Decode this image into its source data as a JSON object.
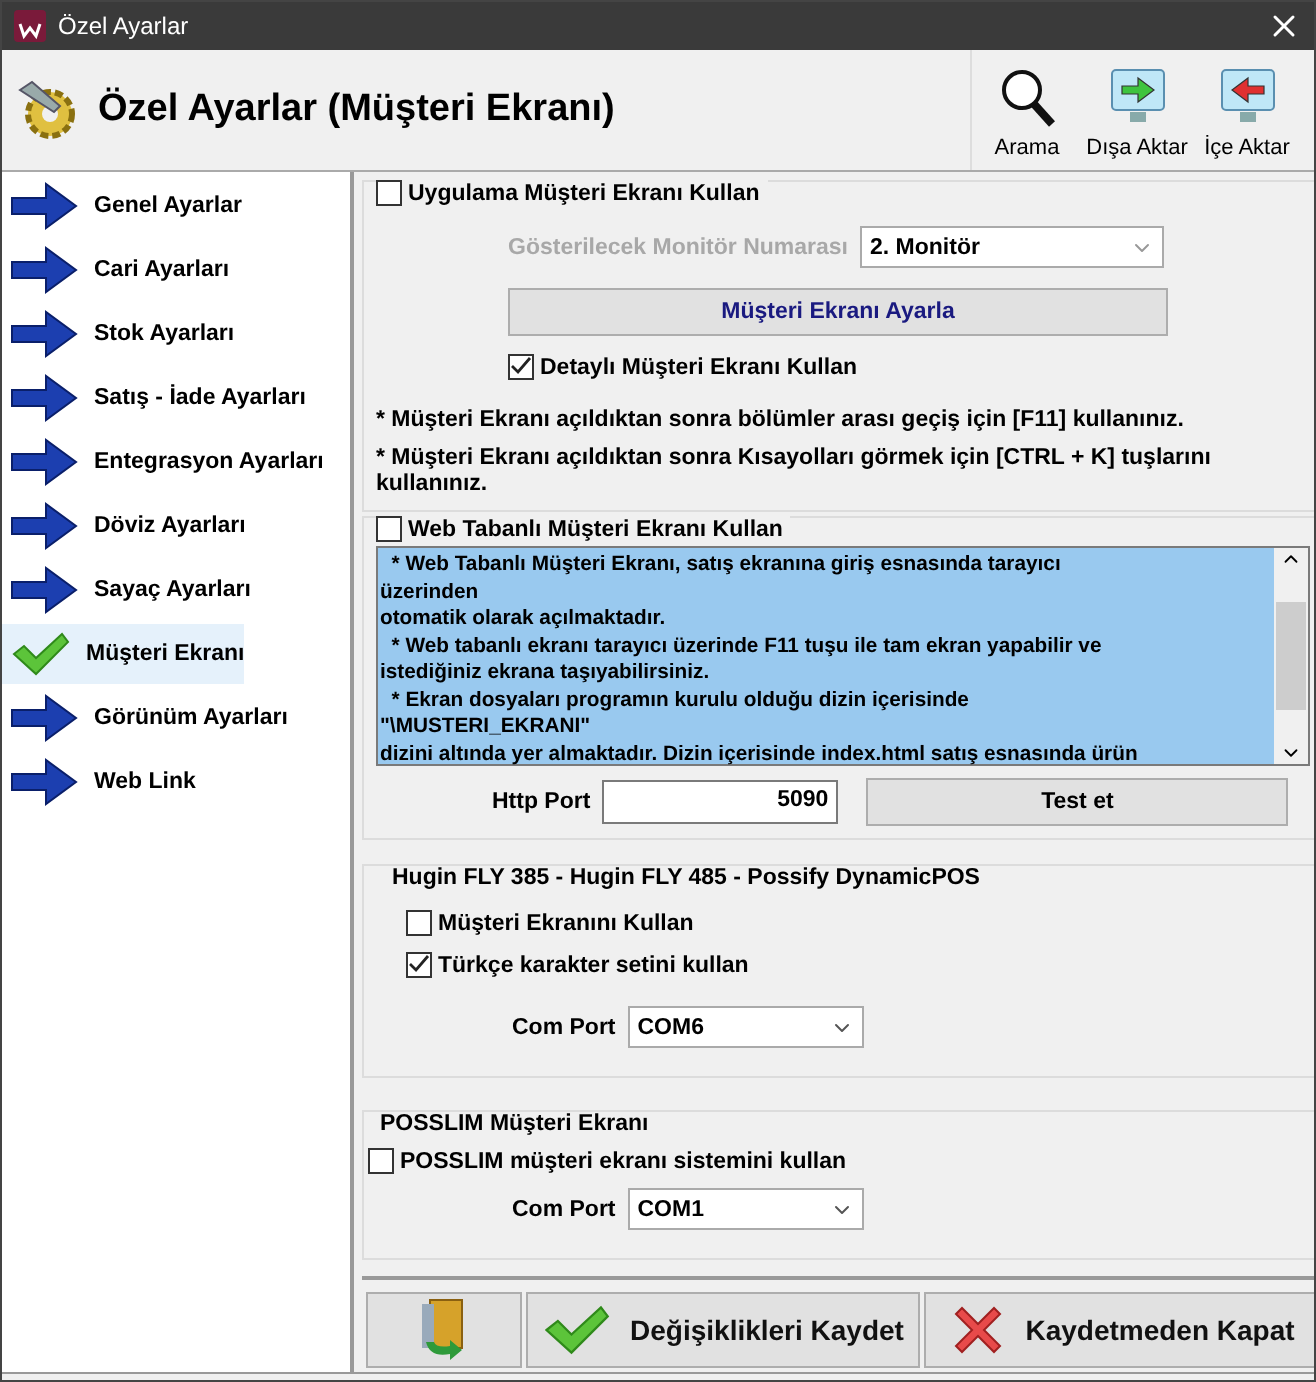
{
  "window": {
    "title": "Özel Ayarlar"
  },
  "header": {
    "title": "Özel Ayarlar (Müşteri Ekranı)",
    "tools": [
      {
        "kind": "search",
        "label": "Arama"
      },
      {
        "kind": "export",
        "label": "Dışa Aktar"
      },
      {
        "kind": "import",
        "label": "İçe Aktar"
      }
    ]
  },
  "sidebar": {
    "items": [
      {
        "label": "Genel Ayarlar",
        "selected": false
      },
      {
        "label": "Cari Ayarları",
        "selected": false
      },
      {
        "label": "Stok Ayarları",
        "selected": false
      },
      {
        "label": "Satış - İade Ayarları",
        "selected": false
      },
      {
        "label": "Entegrasyon Ayarları",
        "selected": false
      },
      {
        "label": "Döviz Ayarları",
        "selected": false
      },
      {
        "label": "Sayaç Ayarları",
        "selected": false
      },
      {
        "label": "Müşteri Ekranı",
        "selected": true
      },
      {
        "label": "Görünüm Ayarları",
        "selected": false
      },
      {
        "label": "Web Link",
        "selected": false
      }
    ]
  },
  "app_screen": {
    "label": "Uygulama Müşteri Ekranı Kullan",
    "checked": false,
    "monitor_label": "Gösterilecek Monitör Numarası",
    "monitor_value": "2. Monitör",
    "setup_button": "Müşteri Ekranı Ayarla",
    "detailed": {
      "label": "Detaylı Müşteri Ekranı Kullan",
      "checked": true
    },
    "notes": [
      "* Müşteri Ekranı  açıldıktan sonra bölümler arası geçiş için [F11] kullanınız.",
      "* Müşteri Ekranı  açıldıktan sonra Kısayolları görmek için [CTRL + K] tuşlarını kullanınız."
    ]
  },
  "web_screen": {
    "label": "Web Tabanlı Müşteri Ekranı Kullan",
    "checked": false,
    "memo_lines": [
      "  * Web Tabanlı Müşteri Ekranı, satış ekranına giriş esnasında tarayıcı",
      "üzerinden",
      "otomatik olarak açılmaktadır.",
      "  * Web tabanlı ekranı tarayıcı üzerinde F11 tuşu ile tam ekran yapabilir ve",
      "istediğiniz ekrana taşıyabilirsiniz.",
      "  * Ekran dosyaları programın kurulu olduğu dizin içerisinde",
      "\"\\MUSTERI_EKRANI\"",
      "dizini altında yer almaktadır. Dizin içerisinde index.html satış esnasında ürün"
    ],
    "port_label": "Http Port",
    "port_value": "5090",
    "test_button": "Test et"
  },
  "hugin": {
    "title": "Hugin FLY 385 - Hugin FLY 485 - Possify DynamicPOS",
    "options": [
      {
        "label": "Müşteri Ekranını Kullan",
        "checked": false
      },
      {
        "label": "Türkçe karakter setini kullan",
        "checked": true
      }
    ],
    "port_label": "Com Port",
    "port_value": "COM6"
  },
  "posslim": {
    "title": "POSSLIM Müşteri Ekranı",
    "option": {
      "label": "POSSLIM müşteri ekranı sistemini kullan",
      "checked": false
    },
    "port_label": "Com Port",
    "port_value": "COM1"
  },
  "footer": {
    "buttons": [
      {
        "kind": "exit"
      },
      {
        "kind": "save",
        "label": "Değişiklikleri Kaydet"
      },
      {
        "kind": "cancel",
        "label": "Kaydetmeden Kapat"
      }
    ]
  }
}
